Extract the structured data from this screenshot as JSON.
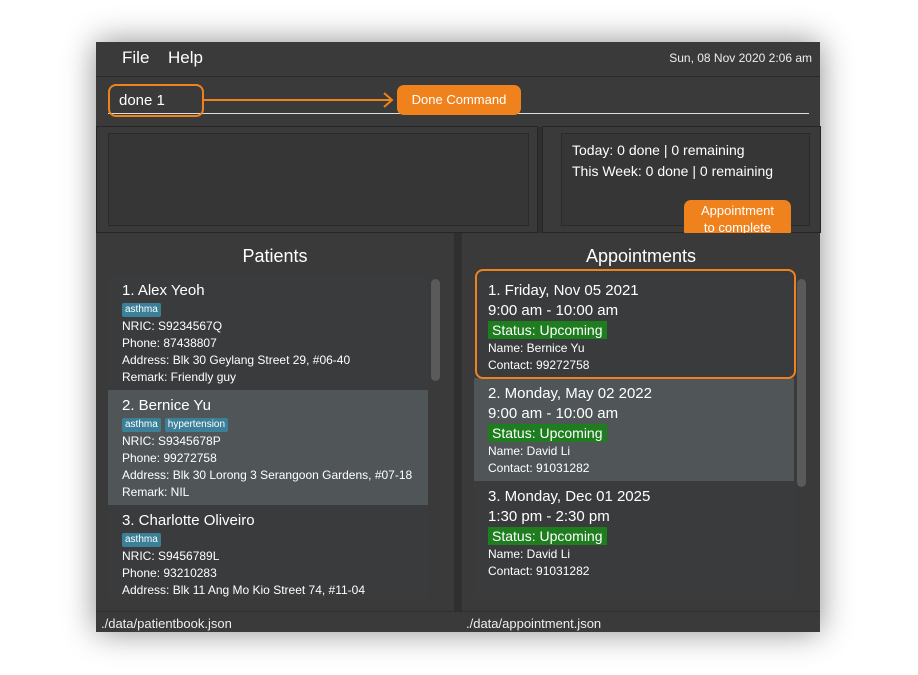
{
  "menu": {
    "file": "File",
    "help": "Help"
  },
  "clock": "Sun, 08 Nov 2020 2:06 am",
  "command": {
    "value": "done 1"
  },
  "callouts": {
    "command": "Done Command",
    "appointment_line1": "Appointment",
    "appointment_line2": "to complete"
  },
  "stats": {
    "today": "Today: 0 done | 0 remaining",
    "week": "This Week: 0 done | 0 remaining"
  },
  "patients": {
    "title": "Patients",
    "items": [
      {
        "name": "1.  Alex Yeoh",
        "tags": [
          "asthma"
        ],
        "nric": "NRIC: S9234567Q",
        "phone": "Phone: 87438807",
        "address": "Address: Blk 30 Geylang Street 29, #06-40",
        "remark": "Remark: Friendly guy"
      },
      {
        "name": "2.  Bernice Yu",
        "tags": [
          "asthma",
          "hypertension"
        ],
        "nric": "NRIC: S9345678P",
        "phone": "Phone: 99272758",
        "address": "Address: Blk 30 Lorong 3 Serangoon Gardens, #07-18",
        "remark": "Remark: NIL"
      },
      {
        "name": "3.  Charlotte Oliveiro",
        "tags": [
          "asthma"
        ],
        "nric": "NRIC: S9456789L",
        "phone": "Phone: 93210283",
        "address": "Address: Blk 11 Ang Mo Kio Street 74, #11-04",
        "remark": ""
      }
    ]
  },
  "appointments": {
    "title": "Appointments",
    "items": [
      {
        "date": "1.  Friday, Nov 05 2021",
        "time": "9:00 am - 10:00 am",
        "status": "Status: Upcoming",
        "name": "Name: Bernice Yu",
        "contact": "Contact: 99272758"
      },
      {
        "date": "2.  Monday, May 02 2022",
        "time": "9:00 am - 10:00 am",
        "status": "Status: Upcoming",
        "name": "Name: David Li",
        "contact": "Contact: 91031282"
      },
      {
        "date": "3.  Monday, Dec 01 2025",
        "time": "1:30 pm - 2:30 pm",
        "status": "Status: Upcoming",
        "name": "Name: David Li",
        "contact": "Contact: 91031282"
      }
    ]
  },
  "statusbar": {
    "patients_file": "./data/patientbook.json",
    "appointments_file": "./data/appointment.json"
  },
  "colors": {
    "accent": "#f0821e",
    "tag": "#3c7f99",
    "status": "#1e7d1e"
  }
}
